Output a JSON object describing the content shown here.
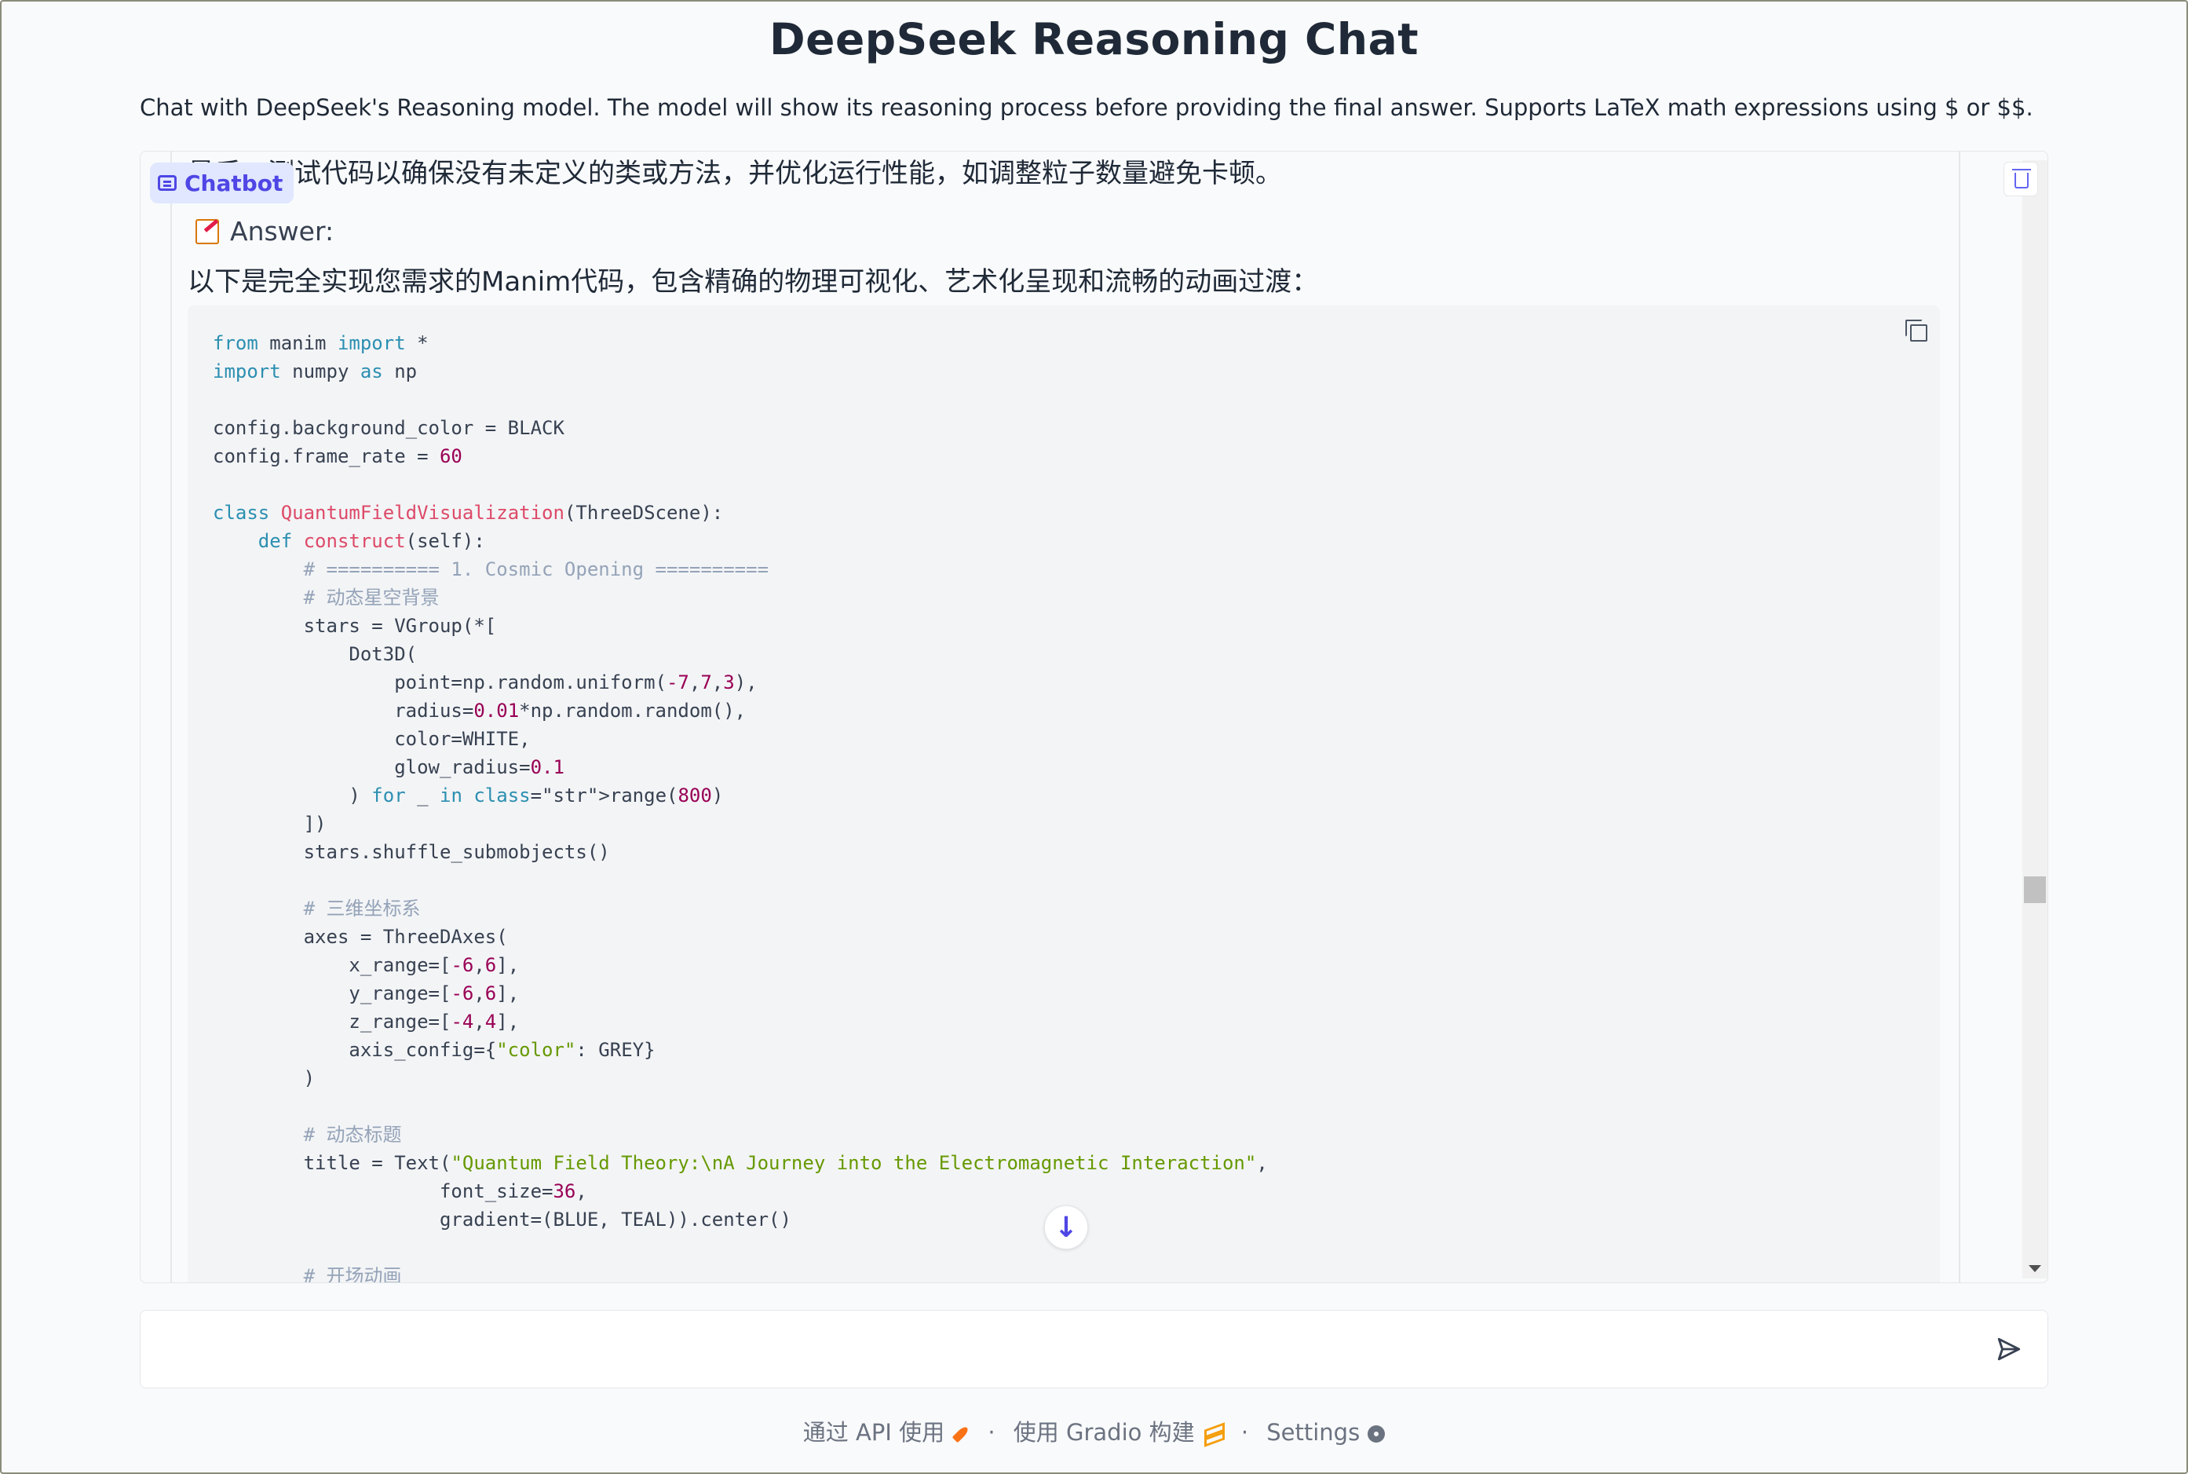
{
  "app": {
    "title": "DeepSeek Reasoning Chat",
    "description": "Chat with DeepSeek's Reasoning model. The model will show its reasoning process before providing the final answer. Supports LaTeX math expressions using $ or $$."
  },
  "chatbot": {
    "label": "Chatbot",
    "previous_text": "最后，测试代码以确保没有未定义的类或方法，并优化运行性能，如调整粒子数量避免卡顿。",
    "answer_heading": "Answer:",
    "answer_intro": "以下是完全实现您需求的Manim代码，包含精确的物理可视化、艺术化呈现和流畅的动画过渡：",
    "code_lines": [
      "from manim import *",
      "import numpy as np",
      "",
      "config.background_color = BLACK",
      "config.frame_rate = 60",
      "",
      "class QuantumFieldVisualization(ThreeDScene):",
      "    def construct(self):",
      "        # ========== 1. Cosmic Opening ==========",
      "        # 动态星空背景",
      "        stars = VGroup(*[",
      "            Dot3D(",
      "                point=np.random.uniform(-7,7,3),",
      "                radius=0.01*np.random.random(),",
      "                color=WHITE,",
      "                glow_radius=0.1",
      "            ) for _ in range(800)",
      "        ])",
      "        stars.shuffle_submobjects()",
      "",
      "        # 三维坐标系",
      "        axes = ThreeDAxes(",
      "            x_range=[-6,6],",
      "            y_range=[-6,6],",
      "            z_range=[-4,4],",
      "            axis_config={\"color\": GREY}",
      "        )",
      "",
      "        # 动态标题",
      "        title = Text(\"Quantum Field Theory:\\nA Journey into the Electromagnetic Interaction\",",
      "                    font_size=36,",
      "                    gradient=(BLUE, TEAL)).center()",
      "",
      "        # 开场动画"
    ]
  },
  "input": {
    "value": "",
    "placeholder": ""
  },
  "footer": {
    "api_text": "通过 API 使用",
    "separator": "·",
    "gradio_text": "使用 Gradio 构建",
    "settings_text": "Settings"
  },
  "icons": {
    "chatbot": "chat-bubble-icon",
    "copy": "copy-icon",
    "trash": "trash-icon",
    "scroll_down": "arrow-down-icon",
    "send": "send-icon",
    "api": "rocket-icon",
    "gradio": "stack-icon",
    "settings": "gear-icon"
  },
  "colors": {
    "accent": "#4f46e5",
    "keyword": "#2b8fb1",
    "function": "#dd4a68",
    "number": "#990055",
    "string": "#669900",
    "comment": "#94a3b8"
  }
}
